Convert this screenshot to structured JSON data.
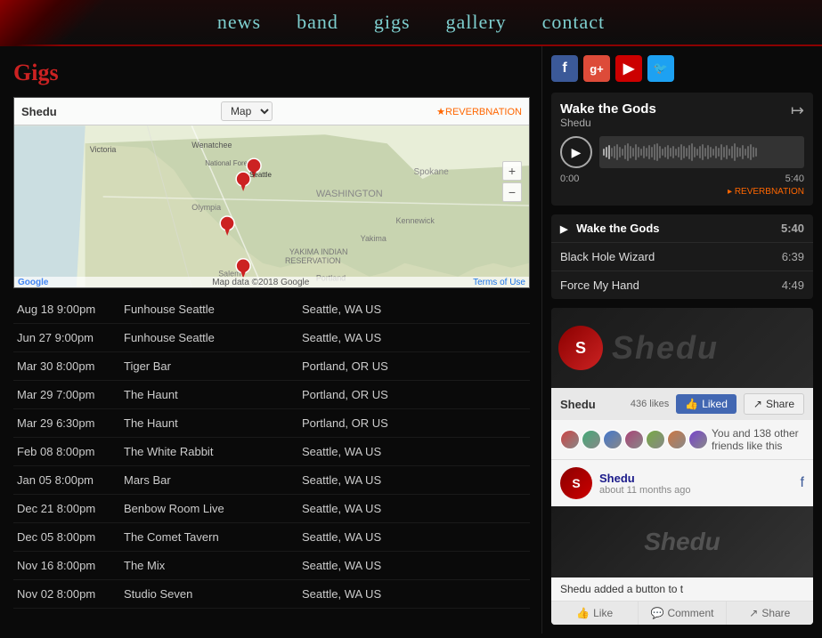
{
  "header": {
    "nav_items": [
      {
        "label": "news",
        "href": "#"
      },
      {
        "label": "band",
        "href": "#"
      },
      {
        "label": "gigs",
        "href": "#"
      },
      {
        "label": "gallery",
        "href": "#"
      },
      {
        "label": "contact",
        "href": "#"
      }
    ]
  },
  "gigs_section": {
    "title": "Gigs",
    "map_title": "Shedu",
    "map_reverbnation": "★REVERBNATION",
    "map_type": "Map",
    "map_data_credit": "Map data ©2018 Google",
    "map_terms": "Terms of Use",
    "gigs": [
      {
        "date": "Aug 18 9:00pm",
        "venue": "Funhouse Seattle",
        "location": "Seattle, WA US"
      },
      {
        "date": "Jun 27 9:00pm",
        "venue": "Funhouse Seattle",
        "location": "Seattle, WA US"
      },
      {
        "date": "Mar 30 8:00pm",
        "venue": "Tiger Bar",
        "location": "Portland, OR US"
      },
      {
        "date": "Mar 29 7:00pm",
        "venue": "The Haunt",
        "location": "Portland, OR US"
      },
      {
        "date": "Mar 29 6:30pm",
        "venue": "The Haunt",
        "location": "Portland, OR US"
      },
      {
        "date": "Feb 08 8:00pm",
        "venue": "The White Rabbit",
        "location": "Seattle, WA US"
      },
      {
        "date": "Jan 05 8:00pm",
        "venue": "Mars Bar",
        "location": "Seattle, WA US"
      },
      {
        "date": "Dec 21 8:00pm",
        "venue": "Benbow Room Live",
        "location": "Seattle, WA US"
      },
      {
        "date": "Dec 05 8:00pm",
        "venue": "The Comet Tavern",
        "location": "Seattle, WA US"
      },
      {
        "date": "Nov 16 8:00pm",
        "venue": "The Mix",
        "location": "Seattle, WA US"
      },
      {
        "date": "Nov 02 8:00pm",
        "venue": "Studio Seven",
        "location": "Seattle, WA US"
      }
    ]
  },
  "right_panel": {
    "social_icons": [
      {
        "name": "facebook",
        "label": "f"
      },
      {
        "name": "google-plus",
        "label": "g+"
      },
      {
        "name": "youtube",
        "label": "▶"
      },
      {
        "name": "twitter",
        "label": "t"
      }
    ],
    "player": {
      "track_title": "Wake the Gods",
      "artist": "Shedu",
      "time_current": "0:00",
      "time_total": "5:40",
      "reverbnation_label": "▸ REVERBNATION"
    },
    "tracks": [
      {
        "title": "Wake the Gods",
        "duration": "5:40",
        "active": true
      },
      {
        "title": "Black Hole Wizard",
        "duration": "6:39",
        "active": false
      },
      {
        "title": "Force My Hand",
        "duration": "4:49",
        "active": false
      }
    ],
    "facebook_widget": {
      "page_name": "Shedu",
      "likes": "436 likes",
      "liked_label": "Liked",
      "share_label": "Share",
      "friends_text": "You and 138 other friends like this",
      "post_name": "Shedu",
      "post_time": "about 11 months ago",
      "post_caption": "Shedu added a button to t",
      "actions": [
        "Like",
        "Comment",
        "Share"
      ]
    }
  }
}
